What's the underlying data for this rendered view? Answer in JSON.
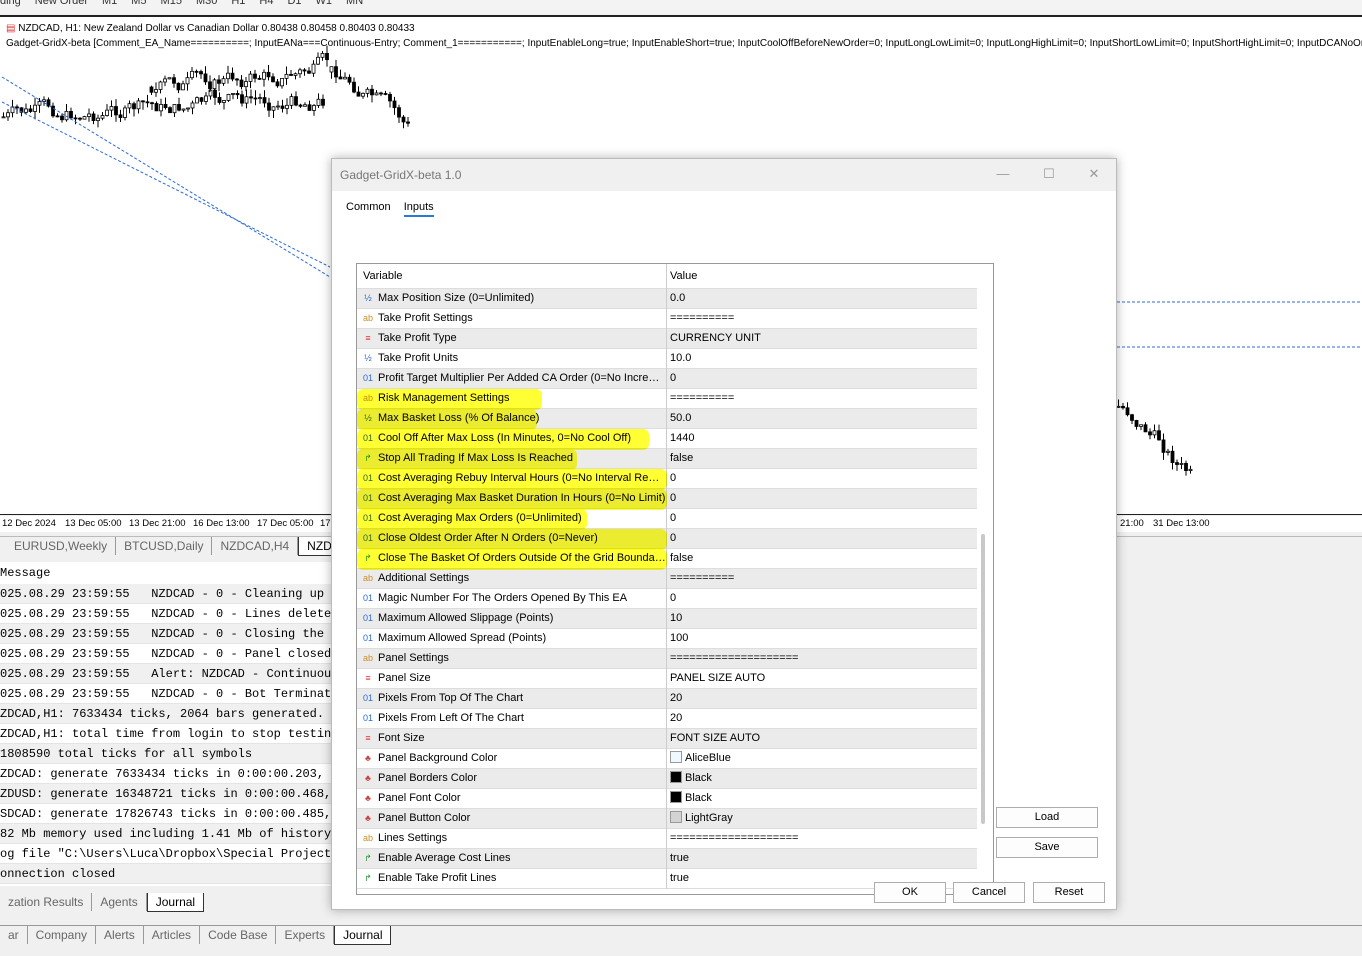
{
  "toolbar": {
    "items": [
      "ding",
      "New Order",
      "M1",
      "M5",
      "M15",
      "M30",
      "H1",
      "H4",
      "D1",
      "W1",
      "MN"
    ]
  },
  "chart": {
    "info_line": "NZDCAD, H1:  New Zealand Dollar vs Canadian Dollar  0.80438 0.80458 0.80403 0.80433",
    "ea_line": "Gadget-GridX-beta [Comment_EA_Name==========; InputEANa===Continuous-Entry; Comment_1===========; InputEnableLong=true; InputEnableShort=true; InputCoolOffBeforeNewOrder=0; InputLongLowLimit=0; InputLongHighLimit=0; InputShortLowLimit=0; InputShortHighLimit=0; InputDCANoOrdersO",
    "time_axis": [
      "12 Dec 2024",
      "13 Dec 05:00",
      "13 Dec 21:00",
      "16 Dec 13:00",
      "17 Dec 05:00",
      "17",
      "21:00",
      "31 Dec 13:00"
    ],
    "colors": {
      "bull": "#000000",
      "bear": "#000000",
      "trade_line": "#e8402a",
      "trend_line": "#2a6ad5"
    }
  },
  "chart_tabs": [
    "EURUSD,Weekly",
    "BTCUSD,Daily",
    "NZDCAD,H4",
    "NZD"
  ],
  "journal": {
    "header": "Message",
    "rows": [
      "025.08.29 23:59:55   NZDCAD - 0 - Cleaning up th",
      "025.08.29 23:59:55   NZDCAD - 0 - Lines deleted",
      "025.08.29 23:59:55   NZDCAD - 0 - Closing the pa",
      "025.08.29 23:59:55   NZDCAD - 0 - Panel closed",
      "025.08.29 23:59:55   Alert: NZDCAD - Continuous-",
      "025.08.29 23:59:55   NZDCAD - 0 - Bot Terminated",
      "ZDCAD,H1: 7633434 ticks, 2064 bars generated. En",
      "ZDCAD,H1: total time from login to stop testing",
      "1808590 total ticks for all symbols",
      "ZDCAD: generate 7633434 ticks in 0:00:00.203, pa",
      "ZDUSD: generate 16348721 ticks in 0:00:00.468, p",
      "SDCAD: generate 17826743 ticks in 0:00:00.485, p",
      "82 Mb memory used including 1.41 Mb of history d",
      "og file \"C:\\Users\\Luca\\Dropbox\\Special Projects\\",
      "onnection closed"
    ]
  },
  "tester_tabs": [
    "zation Results",
    "Agents",
    "Journal"
  ],
  "toolbox_tabs": [
    "ar",
    "Company",
    "Alerts",
    "Articles",
    "Code Base",
    "Experts",
    "Journal"
  ],
  "dialog": {
    "title": "Gadget-GridX-beta 1.0",
    "tabs": [
      "Common",
      "Inputs"
    ],
    "active_tab": "Inputs",
    "columns": [
      "Variable",
      "Value"
    ],
    "rows": [
      {
        "icon": "double",
        "name": "Max Position Size (0=Unlimited)",
        "value": "0.0"
      },
      {
        "icon": "string",
        "name": "Take Profit Settings",
        "value": "=========="
      },
      {
        "icon": "enum",
        "name": "Take Profit Type",
        "value": "CURRENCY UNIT"
      },
      {
        "icon": "double",
        "name": "Take Profit Units",
        "value": "10.0"
      },
      {
        "icon": "int",
        "name": "Profit Target Multiplier Per Added CA Order (0=No Incre…",
        "value": "0"
      },
      {
        "icon": "string",
        "name": "Risk Management Settings",
        "value": "=========="
      },
      {
        "icon": "double",
        "name": "Max Basket Loss (% Of Balance)",
        "value": "50.0"
      },
      {
        "icon": "int",
        "name": "Cool Off After Max Loss (In Minutes, 0=No Cool Off)",
        "value": "1440"
      },
      {
        "icon": "bool",
        "name": "Stop All Trading If Max Loss Is Reached",
        "value": "false"
      },
      {
        "icon": "int",
        "name": "Cost Averaging Rebuy Interval Hours (0=No Interval Re…",
        "value": "0"
      },
      {
        "icon": "int",
        "name": "Cost Averaging Max Basket Duration In Hours (0=No Limit)",
        "value": "0"
      },
      {
        "icon": "int",
        "name": "Cost Averaging Max Orders (0=Unlimited)",
        "value": "0"
      },
      {
        "icon": "int",
        "name": "Close Oldest Order After N Orders (0=Never)",
        "value": "0"
      },
      {
        "icon": "bool",
        "name": "Close The Basket Of Orders Outside Of the Grid Bounda…",
        "value": "false"
      },
      {
        "icon": "string",
        "name": "Additional Settings",
        "value": "=========="
      },
      {
        "icon": "int",
        "name": "Magic Number For The Orders Opened By This EA",
        "value": "0"
      },
      {
        "icon": "int",
        "name": "Maximum Allowed Slippage (Points)",
        "value": "10"
      },
      {
        "icon": "int",
        "name": "Maximum Allowed Spread (Points)",
        "value": "100"
      },
      {
        "icon": "string",
        "name": "Panel Settings",
        "value": "===================="
      },
      {
        "icon": "enum",
        "name": "Panel Size",
        "value": "PANEL SIZE AUTO"
      },
      {
        "icon": "int",
        "name": "Pixels From Top Of The Chart",
        "value": "20"
      },
      {
        "icon": "int",
        "name": "Pixels From Left Of The Chart",
        "value": "20"
      },
      {
        "icon": "enum",
        "name": "Font Size",
        "value": "FONT SIZE AUTO"
      },
      {
        "icon": "color",
        "name": "Panel Background Color",
        "value": "AliceBlue",
        "swatch": "#F0F8FF"
      },
      {
        "icon": "color",
        "name": "Panel Borders Color",
        "value": "Black",
        "swatch": "#000000"
      },
      {
        "icon": "color",
        "name": "Panel Font Color",
        "value": "Black",
        "swatch": "#000000"
      },
      {
        "icon": "color",
        "name": "Panel Button Color",
        "value": "LightGray",
        "swatch": "#D3D3D3"
      },
      {
        "icon": "string",
        "name": "Lines Settings",
        "value": "===================="
      },
      {
        "icon": "bool",
        "name": "Enable Average Cost Lines",
        "value": "true"
      },
      {
        "icon": "bool",
        "name": "Enable Take Profit Lines",
        "value": "true"
      }
    ],
    "highlighted_rows": [
      "Risk Management Settings",
      "Max Basket Loss (% Of Balance)",
      "Cool Off After Max Loss (In Minutes, 0=No Cool Off)",
      "Stop All Trading If Max Loss Is Reached",
      "Cost Averaging Rebuy Interval Hours (0=No Interval Re…",
      "Cost Averaging Max Basket Duration In Hours (0=No Limit)",
      "Cost Averaging Max Orders (0=Unlimited)",
      "Close Oldest Order After N Orders (0=Never)",
      "Close The Basket Of Orders Outside Of the Grid Bounda…"
    ],
    "highlight_color": "#FFFF00",
    "buttons": {
      "load": "Load",
      "save": "Save",
      "ok": "OK",
      "cancel": "Cancel",
      "reset": "Reset"
    }
  }
}
